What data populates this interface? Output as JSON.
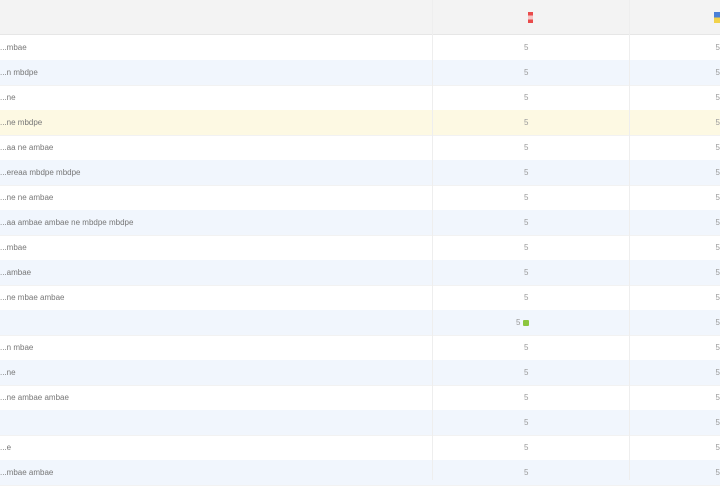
{
  "header": {
    "flag_a_icon": "red-flag-icon",
    "flag_b_icon": "ukraine-flag-icon"
  },
  "rows": [
    {
      "label": "...mbae",
      "a": "5",
      "b": "5"
    },
    {
      "label": "...n mbdpe",
      "a": "5",
      "b": "5"
    },
    {
      "label": "...ne",
      "a": "5",
      "b": "5"
    },
    {
      "label": "...ne mbdpe",
      "a": "5",
      "b": "5"
    },
    {
      "label": "...aa ne ambae",
      "a": "5",
      "b": "5"
    },
    {
      "label": "...ereaa mbdpe mbdpe",
      "a": "5",
      "b": "5"
    },
    {
      "label": "...ne ne ambae",
      "a": "5",
      "b": "5"
    },
    {
      "label": "...aa ambae ambae ne mbdpe mbdpe",
      "a": "5",
      "b": "5"
    },
    {
      "label": "...mbae",
      "a": "5",
      "b": "5"
    },
    {
      "label": "...ambae",
      "a": "5",
      "b": "5"
    },
    {
      "label": "...ne mbae ambae",
      "a": "5",
      "b": "5"
    },
    {
      "label": "",
      "a": "5",
      "b": "5"
    },
    {
      "label": "...n mbae",
      "a": "5",
      "b": "5"
    },
    {
      "label": "...ne",
      "a": "5",
      "b": "5"
    },
    {
      "label": "...ne ambae ambae",
      "a": "5",
      "b": "5"
    },
    {
      "label": "",
      "a": "5",
      "b": "5"
    },
    {
      "label": "...e",
      "a": "5",
      "b": "5"
    },
    {
      "label": "...mbae ambae",
      "a": "5",
      "b": "5"
    }
  ]
}
